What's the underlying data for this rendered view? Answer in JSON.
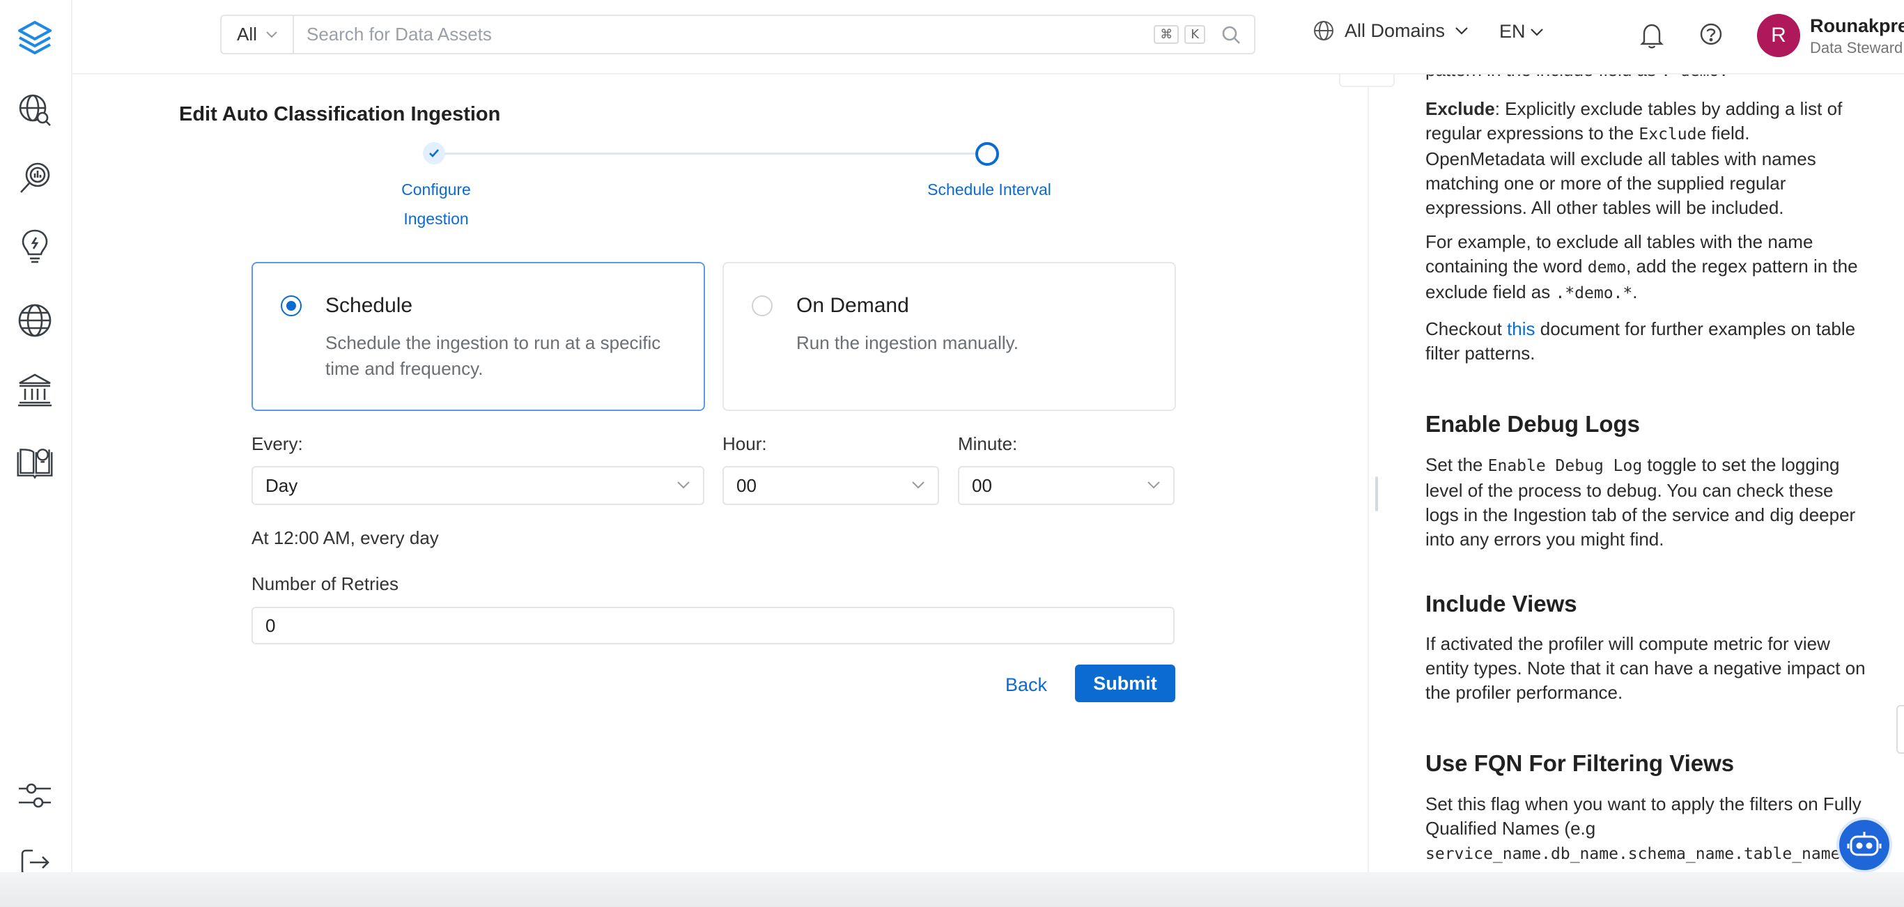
{
  "colors": {
    "primary": "#0b6bd1",
    "avatar": "#b0185c",
    "border": "#e3e5e8"
  },
  "sidebar": {
    "items": [
      {
        "name": "explore",
        "icon": "globe-search-icon"
      },
      {
        "name": "data-quality",
        "icon": "magnifier-chart-icon"
      },
      {
        "name": "insights",
        "icon": "lightbulb-icon"
      },
      {
        "name": "domains",
        "icon": "globe-icon"
      },
      {
        "name": "governance",
        "icon": "bank-icon"
      },
      {
        "name": "knowledge",
        "icon": "book-lightbulb-icon"
      }
    ],
    "bottom": [
      {
        "name": "settings",
        "icon": "sliders-icon"
      },
      {
        "name": "logout",
        "icon": "logout-icon"
      }
    ]
  },
  "topnav": {
    "search_filter": "All",
    "search_placeholder": "Search for Data Assets",
    "shortcut_cmd": "⌘",
    "shortcut_key": "K",
    "domains_label": "All Domains",
    "language": "EN",
    "user": {
      "initial": "R",
      "name": "Rounakpreet.d",
      "role": "Data Steward"
    }
  },
  "form": {
    "title": "Edit Auto Classification Ingestion",
    "steps": [
      {
        "label_line1": "Configure",
        "label_line2": "Ingestion",
        "status": "done"
      },
      {
        "label_line1": "Schedule Interval",
        "label_line2": "",
        "status": "active"
      }
    ],
    "schedule_option": {
      "title": "Schedule",
      "desc": "Schedule the ingestion to run at a specific time and frequency.",
      "selected": true
    },
    "ondemand_option": {
      "title": "On Demand",
      "desc": "Run the ingestion manually.",
      "selected": false
    },
    "every_label": "Every:",
    "every_value": "Day",
    "hour_label": "Hour:",
    "hour_value": "00",
    "minute_label": "Minute:",
    "minute_value": "00",
    "summary": "At 12:00 AM, every day",
    "retries_label": "Number of Retries",
    "retries_value": "0",
    "back_label": "Back",
    "submit_label": "Submit"
  },
  "doc": {
    "top_fragment_pre": "pattern in the include field as ",
    "top_fragment_code": ".*demo.*",
    "exclude_bold": "Exclude",
    "exclude_text_1": ": Explicitly exclude tables by adding a list of regular expressions to the ",
    "exclude_code": "Exclude",
    "exclude_text_2": " field. OpenMetadata will exclude all tables with names matching one or more of the supplied regular expressions. All other tables will be included.",
    "example_text_1": "For example, to exclude all tables with the name containing the word ",
    "example_code_1": "demo",
    "example_text_2": ", add the regex pattern in the exclude field as ",
    "example_code_2": ".*demo.*",
    "example_text_3": ".",
    "checkout_pre": "Checkout ",
    "checkout_link": "this",
    "checkout_post": " document for further examples on table filter patterns.",
    "debug_heading": "Enable Debug Logs",
    "debug_text_1": "Set the ",
    "debug_code": "Enable Debug Log",
    "debug_text_2": " toggle to set the logging level of the process to debug. You can check these logs in the Ingestion tab of the service and dig deeper into any errors you might find.",
    "views_heading": "Include Views",
    "views_text": "If activated the profiler will compute metric for view entity types. Note that it can have a negative impact on the profiler performance.",
    "fqn_heading": "Use FQN For Filtering Views",
    "fqn_text": "Set this flag when you want to apply the filters on Fully Qualified Names (e.g",
    "fqn_code": "service_name.db_name.schema_name.table_name"
  }
}
